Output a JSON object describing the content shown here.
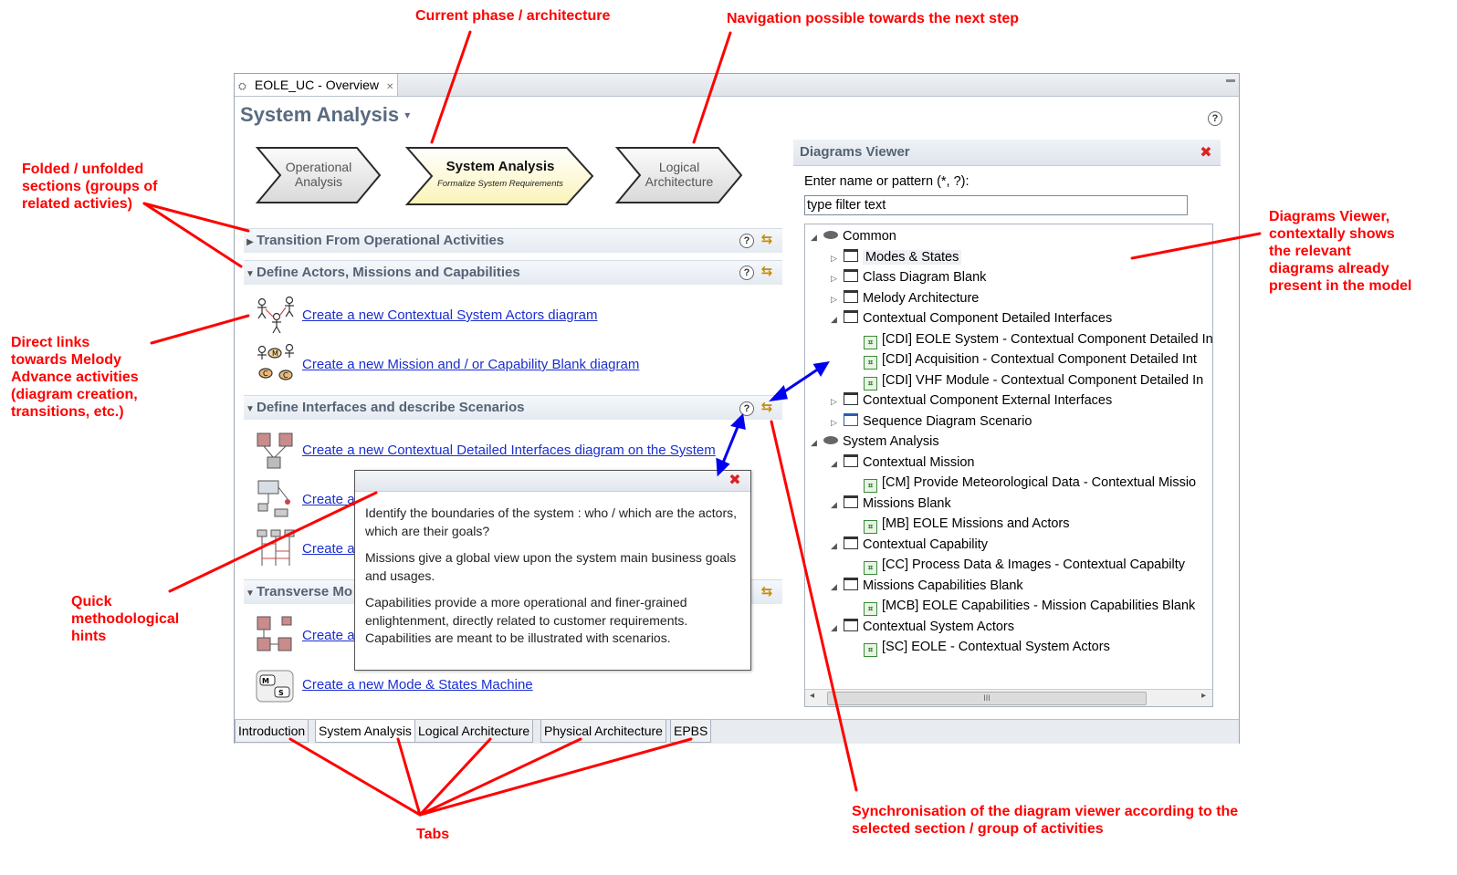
{
  "annotations": {
    "current_phase": "Current phase / architecture",
    "navigation": "Navigation possible towards the next step",
    "folded": [
      "Folded / unfolded",
      "sections (groups of",
      "related activies)"
    ],
    "direct_links": [
      "Direct links",
      "towards Melody",
      "Advance activities",
      "(diagram creation,",
      "transitions, etc.)"
    ],
    "quick_hints": [
      "Quick",
      "methodological",
      "hints"
    ],
    "diagrams_viewer": [
      "Diagrams Viewer,",
      "contextally shows",
      "the relevant",
      "diagrams already",
      "present in the model"
    ],
    "sync": [
      "Synchronisation of the diagram viewer according to the",
      "selected section / group of activities"
    ],
    "tabs": "Tabs",
    "colors": {
      "annotation_text": "#ff0000",
      "arrow_red": "#ff0000",
      "arrow_blue": "#0000ee"
    }
  },
  "editor": {
    "tab_label": "EOLE_UC - Overview",
    "tab_close": "✕",
    "form_title": "System Analysis",
    "help": "?"
  },
  "phases": {
    "prev": {
      "line1": "Operational",
      "line2": "Analysis"
    },
    "current": {
      "title": "System Analysis",
      "subtitle": "Formalize System Requirements"
    },
    "next": {
      "line1": "Logical",
      "line2": "Architecture"
    }
  },
  "sections": [
    {
      "label": "Transition From Operational Activities",
      "expanded": false
    },
    {
      "label": "Define Actors, Missions and Capabilities",
      "expanded": true
    },
    {
      "label": "Define Interfaces and describe Scenarios",
      "expanded": true
    },
    {
      "label": "Transverse Mo",
      "expanded": true
    }
  ],
  "links": {
    "actors": "Create a new Contextual System Actors diagram",
    "mission": "Create a new Mission and / or Capability  Blank diagram",
    "interfaces": "Create a new Contextual Detailed Interfaces diagram on the System",
    "partial1": "Create a",
    "partial2": "Create a",
    "partial3": "Create a",
    "modes": "Create a new Mode & States Machine"
  },
  "hint": {
    "p1": " Identify the boundaries of the system : who / which are the actors, which are their goals?",
    "p2": " Missions give a global view upon the system main business goals and usages.",
    "p3": "Capabilities provide a more operational and finer-grained enlightenment, directly related to customer requirements. Capabilities are meant to be illustrated with scenarios."
  },
  "diagrams_viewer": {
    "title": "Diagrams Viewer",
    "filter_label": "Enter name or pattern (*, ?):",
    "filter_value": "type filter text",
    "scroll_mark": "III",
    "tree": [
      {
        "label": "Common",
        "level": 0,
        "icon": "eye",
        "twisty": "open"
      },
      {
        "label": "Modes & States",
        "level": 1,
        "icon": "folder",
        "twisty": "closed"
      },
      {
        "label": "Class Diagram Blank",
        "level": 1,
        "icon": "folder",
        "twisty": "closed"
      },
      {
        "label": "Melody Architecture",
        "level": 1,
        "icon": "folder",
        "twisty": "closed"
      },
      {
        "label": "Contextual Component Detailed Interfaces",
        "level": 1,
        "icon": "folder",
        "twisty": "open"
      },
      {
        "label": "[CDI] EOLE System - Contextual Component Detailed In",
        "level": 2,
        "icon": "diagram",
        "twisty": ""
      },
      {
        "label": "[CDI] Acquisition - Contextual Component Detailed Int",
        "level": 2,
        "icon": "diagram",
        "twisty": ""
      },
      {
        "label": "[CDI] VHF Module - Contextual Component Detailed In",
        "level": 2,
        "icon": "diagram",
        "twisty": ""
      },
      {
        "label": "Contextual Component External Interfaces",
        "level": 1,
        "icon": "folder",
        "twisty": "closed"
      },
      {
        "label": "Sequence Diagram Scenario",
        "level": 1,
        "icon": "sequence",
        "twisty": "closed"
      },
      {
        "label": "System Analysis",
        "level": 0,
        "icon": "eye",
        "twisty": "open"
      },
      {
        "label": "Contextual Mission",
        "level": 1,
        "icon": "folder",
        "twisty": "open"
      },
      {
        "label": "[CM] Provide Meteorological Data - Contextual Missio",
        "level": 2,
        "icon": "diagram",
        "twisty": ""
      },
      {
        "label": "Missions Blank",
        "level": 1,
        "icon": "folder",
        "twisty": "open"
      },
      {
        "label": "[MB] EOLE Missions and Actors",
        "level": 2,
        "icon": "diagram",
        "twisty": ""
      },
      {
        "label": "Contextual Capability",
        "level": 1,
        "icon": "folder",
        "twisty": "open"
      },
      {
        "label": "[CC] Process Data & Images - Contextual Capabilty",
        "level": 2,
        "icon": "diagram",
        "twisty": ""
      },
      {
        "label": "Missions Capabilities Blank",
        "level": 1,
        "icon": "folder",
        "twisty": "open"
      },
      {
        "label": "[MCB] EOLE Capabilities - Mission Capabilities Blank",
        "level": 2,
        "icon": "diagram",
        "twisty": ""
      },
      {
        "label": "Contextual System Actors",
        "level": 1,
        "icon": "folder",
        "twisty": "open"
      },
      {
        "label": "[SC] EOLE - Contextual System Actors",
        "level": 2,
        "icon": "diagram",
        "twisty": ""
      }
    ]
  },
  "bottom_tabs": [
    {
      "label": "Introduction",
      "active": false
    },
    {
      "label": "System Analysis",
      "active": true
    },
    {
      "label": "Logical Architecture",
      "active": false
    },
    {
      "label": "Physical Architecture",
      "active": false
    },
    {
      "label": "EPBS",
      "active": false
    }
  ]
}
